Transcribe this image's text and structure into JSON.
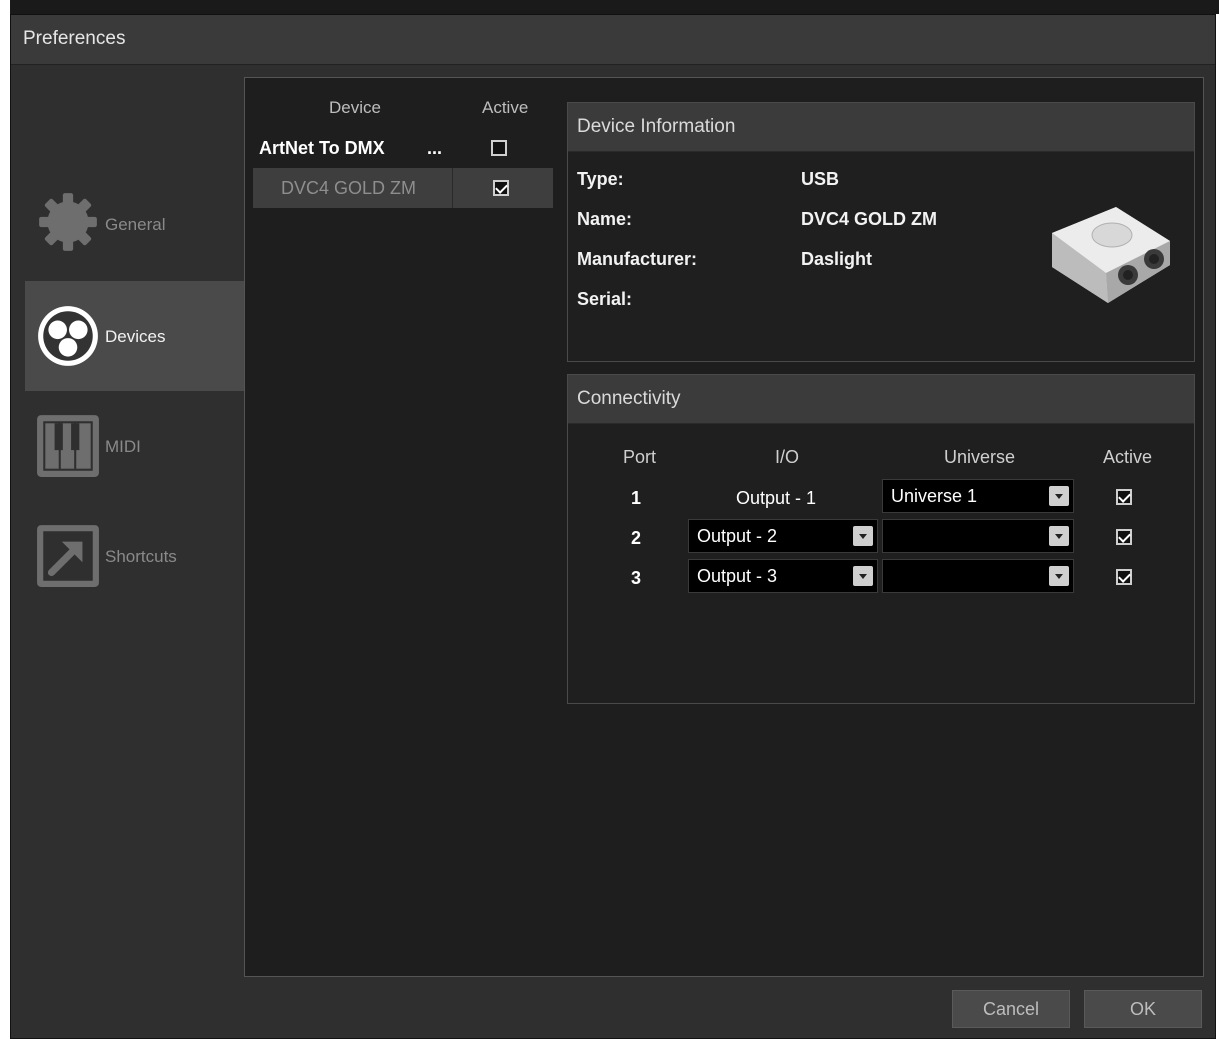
{
  "window": {
    "title": "Preferences"
  },
  "sidebar": {
    "items": [
      {
        "label": "General",
        "icon": "gear-icon"
      },
      {
        "label": "Devices",
        "icon": "devices-icon"
      },
      {
        "label": "MIDI",
        "icon": "piano-keys-icon"
      },
      {
        "label": "Shortcuts",
        "icon": "shortcut-arrow-icon"
      }
    ],
    "active": "Devices"
  },
  "device_list": {
    "headers": {
      "device": "Device",
      "active": "Active"
    },
    "rows": [
      {
        "name": "ArtNet To DMX",
        "ellipsis": "...",
        "active": false
      },
      {
        "name": "DVC4 GOLD ZM",
        "active": true
      }
    ]
  },
  "device_info": {
    "title": "Device Information",
    "labels": {
      "type": "Type:",
      "name": "Name:",
      "manufacturer": "Manufacturer:",
      "serial": "Serial:"
    },
    "values": {
      "type": "USB",
      "name": "DVC4 GOLD ZM",
      "manufacturer": "Daslight",
      "serial": ""
    }
  },
  "connectivity": {
    "title": "Connectivity",
    "headers": {
      "port": "Port",
      "io": "I/O",
      "universe": "Universe",
      "active": "Active"
    },
    "rows": [
      {
        "port": "1",
        "io": "Output - 1",
        "universe": "Universe 1",
        "active": true
      },
      {
        "port": "2",
        "io": "Output - 2",
        "universe": "",
        "active": true
      },
      {
        "port": "3",
        "io": "Output - 3",
        "universe": "",
        "active": true
      }
    ]
  },
  "buttons": {
    "cancel": "Cancel",
    "ok": "OK"
  },
  "colors": {
    "window_bg": "#2f2f2f",
    "content_bg": "#1e1e1e",
    "active_nav": "#4a4a4a"
  }
}
